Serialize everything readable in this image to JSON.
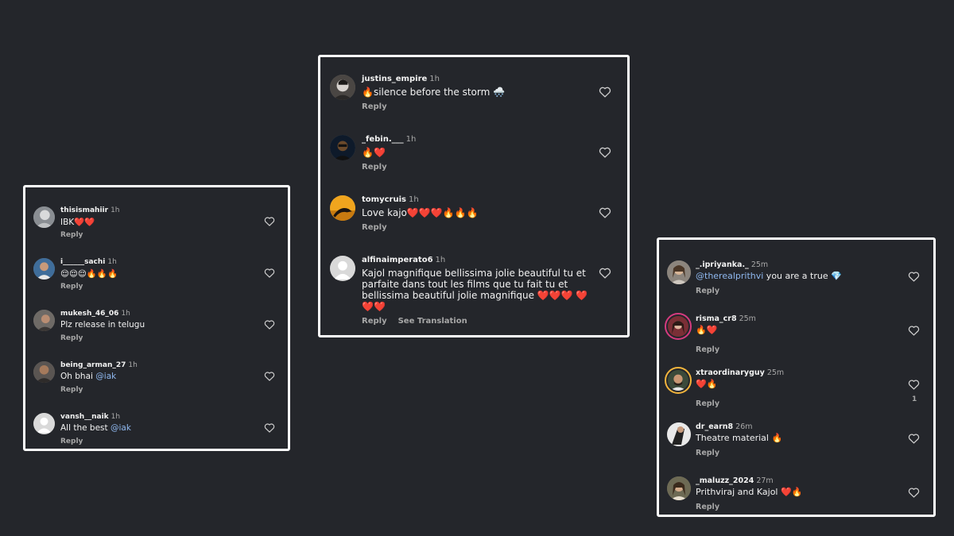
{
  "colors": {
    "background": "#24262b",
    "text": "#f2f2f2",
    "muted": "#a8a8a8",
    "mention": "#8fb8ef",
    "frame": "#ffffff"
  },
  "left_panel": {
    "comments": [
      {
        "user": "thisismahiir",
        "time": "1h",
        "text": "IBK❤️❤️",
        "reply": "Reply",
        "avatar_icon": "person-photo-icon"
      },
      {
        "user": "i______sachi",
        "time": "1h",
        "text": "😌😌😌🔥🔥🔥",
        "reply": "Reply",
        "avatar_icon": "person-photo-icon"
      },
      {
        "user": "mukesh_46_06",
        "time": "1h",
        "text": "Plz release in telugu",
        "reply": "Reply",
        "avatar_icon": "person-photo-icon"
      },
      {
        "user": "being_arman_27",
        "time": "1h",
        "text_prefix": "Oh bhai ",
        "mention": "@iak",
        "reply": "Reply",
        "avatar_icon": "person-photo-icon"
      },
      {
        "user": "vansh__naik",
        "time": "1h",
        "text_prefix": "All the best ",
        "mention": "@iak",
        "reply": "Reply",
        "avatar_icon": "default-avatar-icon"
      }
    ]
  },
  "center_panel": {
    "comments": [
      {
        "user": "justins_empire",
        "time": "1h",
        "text": "🔥silence before the storm 🌨️",
        "reply": "Reply",
        "avatar_icon": "person-photo-icon"
      },
      {
        "user": "_febin.___",
        "time": "1h",
        "text": "🔥❤️",
        "reply": "Reply",
        "avatar_icon": "person-photo-icon"
      },
      {
        "user": "tomycruis",
        "time": "1h",
        "text": "Love kajo❤️❤️❤️🔥🔥🔥",
        "reply": "Reply",
        "avatar_icon": "sunset-photo-icon"
      },
      {
        "user": "alfinaimperato6",
        "time": "1h",
        "text": "Kajol magnifique bellissima jolie beautiful tu et parfaite dans tout les films que tu fait tu et bellissima beautiful jolie magnifique ❤️❤️❤️ ❤️❤️❤️",
        "reply": "Reply",
        "see_translation": "See Translation",
        "avatar_icon": "default-avatar-icon"
      }
    ]
  },
  "right_panel": {
    "comments": [
      {
        "user": "_.ipriyanka._",
        "time": "25m",
        "mention": "@therealprithvi",
        "text_suffix": " you are a true 💎",
        "reply": "Reply",
        "avatar_icon": "person-photo-icon"
      },
      {
        "user": "risma_cr8",
        "time": "25m",
        "text": "🔥❤️",
        "reply": "Reply",
        "avatar_icon": "story-ring-avatar-icon"
      },
      {
        "user": "xtraordinaryguy",
        "time": "25m",
        "text": "❤️🔥",
        "reply": "Reply",
        "like_count": "1",
        "avatar_icon": "story-ring-avatar-icon"
      },
      {
        "user": "dr_earn8",
        "time": "26m",
        "text": "Theatre material 🔥",
        "reply": "Reply",
        "avatar_icon": "person-photo-icon"
      },
      {
        "user": "_maluzz_2024",
        "time": "27m",
        "text": "Prithviraj and Kajol ❤️🔥",
        "reply": "Reply",
        "avatar_icon": "person-photo-icon"
      }
    ]
  }
}
